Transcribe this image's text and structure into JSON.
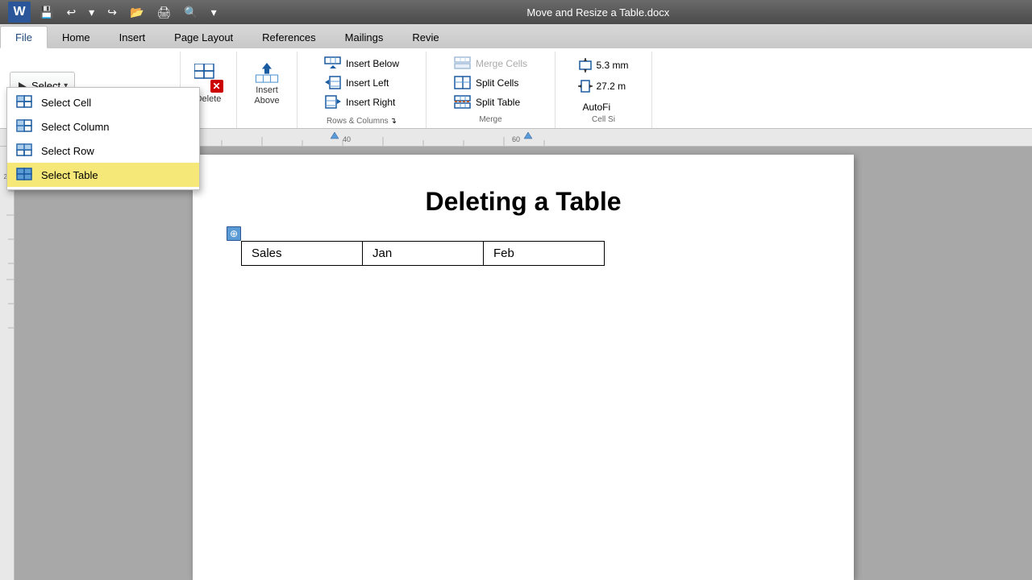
{
  "titleBar": {
    "appName": "W",
    "title": "Move and Resize a Table.docx",
    "tools": [
      "save",
      "undo",
      "undo-drop",
      "redo",
      "open",
      "print",
      "preview",
      "more"
    ]
  },
  "tabs": [
    {
      "label": "File",
      "active": true
    },
    {
      "label": "Home",
      "active": false
    },
    {
      "label": "Insert",
      "active": false
    },
    {
      "label": "Page Layout",
      "active": false
    },
    {
      "label": "References",
      "active": false
    },
    {
      "label": "Mailings",
      "active": false
    },
    {
      "label": "Revie",
      "active": false
    }
  ],
  "ribbon": {
    "selectBtn": "Select",
    "dropdownItems": [
      {
        "label": "Select Cell",
        "highlighted": false
      },
      {
        "label": "Select Column",
        "highlighted": false
      },
      {
        "label": "Select Row",
        "highlighted": false
      },
      {
        "label": "Select Table",
        "highlighted": true
      }
    ],
    "deleteLabel": "Delete",
    "insertAboveLabel": "Insert\nAbove",
    "rowsColsGroup": {
      "label": "Rows & Columns",
      "items": [
        {
          "label": "Insert Below"
        },
        {
          "label": "Insert Left"
        },
        {
          "label": "Insert Right"
        }
      ]
    },
    "mergeGroup": {
      "label": "Merge",
      "items": [
        {
          "label": "Merge Cells",
          "grayed": true
        },
        {
          "label": "Split Cells"
        },
        {
          "label": "Split Table"
        }
      ]
    },
    "cellSizeGroup": {
      "label": "Cell Size",
      "items": [
        {
          "label": "5.3 mm"
        },
        {
          "label": "27.2 m"
        },
        {
          "label": "AutoFi"
        }
      ]
    }
  },
  "document": {
    "title": "Deleting a Table",
    "tableHeaders": [
      "Sales",
      "Jan",
      "Feb"
    ],
    "moveHandleIcon": "⊕"
  }
}
